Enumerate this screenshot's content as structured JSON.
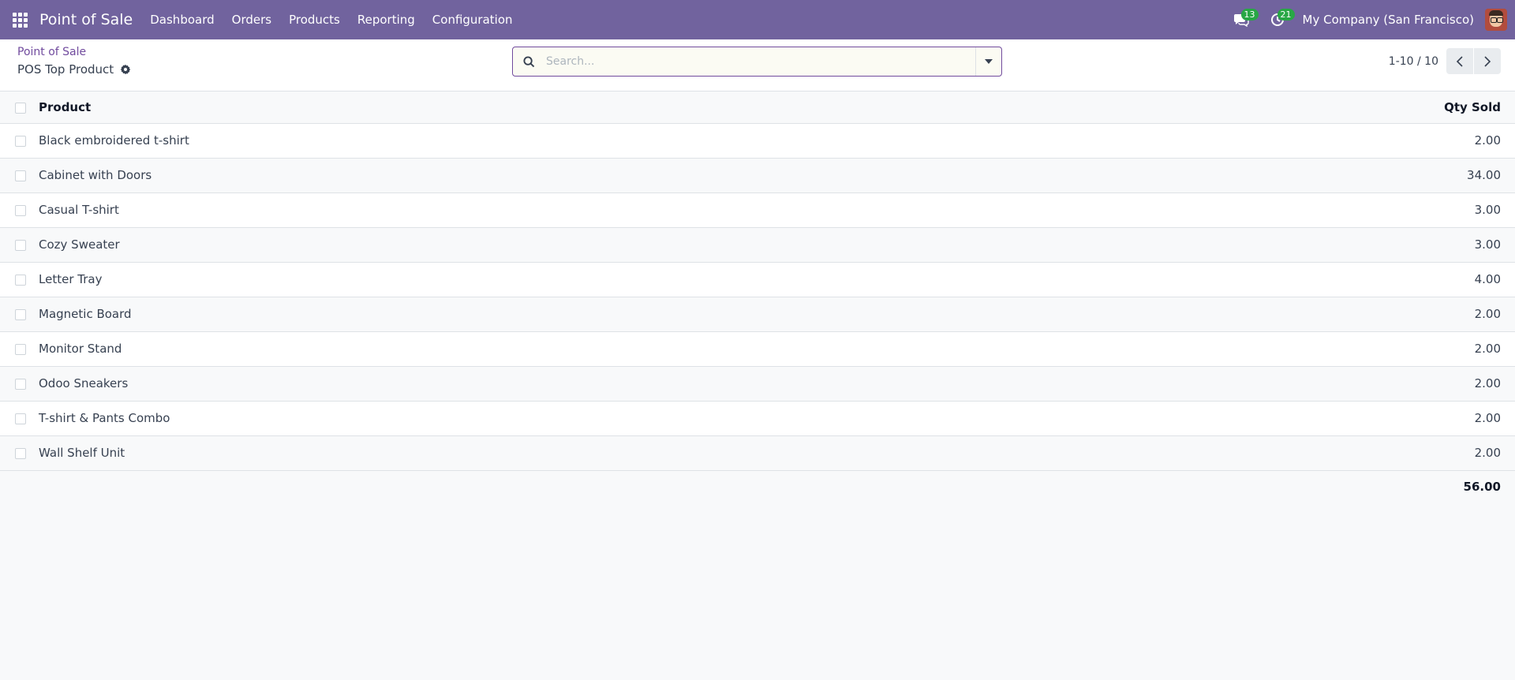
{
  "navbar": {
    "brand": "Point of Sale",
    "menu": [
      "Dashboard",
      "Orders",
      "Products",
      "Reporting",
      "Configuration"
    ],
    "messages_count": "13",
    "activities_count": "21",
    "company": "My Company (San Francisco)"
  },
  "breadcrumb": {
    "parent": "Point of Sale",
    "current": "POS Top Product"
  },
  "search": {
    "placeholder": "Search...",
    "value": ""
  },
  "pager": {
    "value": "1-10 / 10"
  },
  "table": {
    "columns": [
      "Product",
      "Qty Sold"
    ],
    "rows": [
      {
        "product": "Black embroidered t-shirt",
        "qty": "2.00"
      },
      {
        "product": "Cabinet with Doors",
        "qty": "34.00"
      },
      {
        "product": "Casual T-shirt",
        "qty": "3.00"
      },
      {
        "product": "Cozy Sweater",
        "qty": "3.00"
      },
      {
        "product": "Letter Tray",
        "qty": "4.00"
      },
      {
        "product": "Magnetic Board",
        "qty": "2.00"
      },
      {
        "product": "Monitor Stand",
        "qty": "2.00"
      },
      {
        "product": "Odoo Sneakers",
        "qty": "2.00"
      },
      {
        "product": "T-shirt & Pants Combo",
        "qty": "2.00"
      },
      {
        "product": "Wall Shelf Unit",
        "qty": "2.00"
      }
    ],
    "total": "56.00"
  },
  "colors": {
    "navbar": "#71639e",
    "accent": "#714b9e",
    "badge": "#28a745"
  }
}
